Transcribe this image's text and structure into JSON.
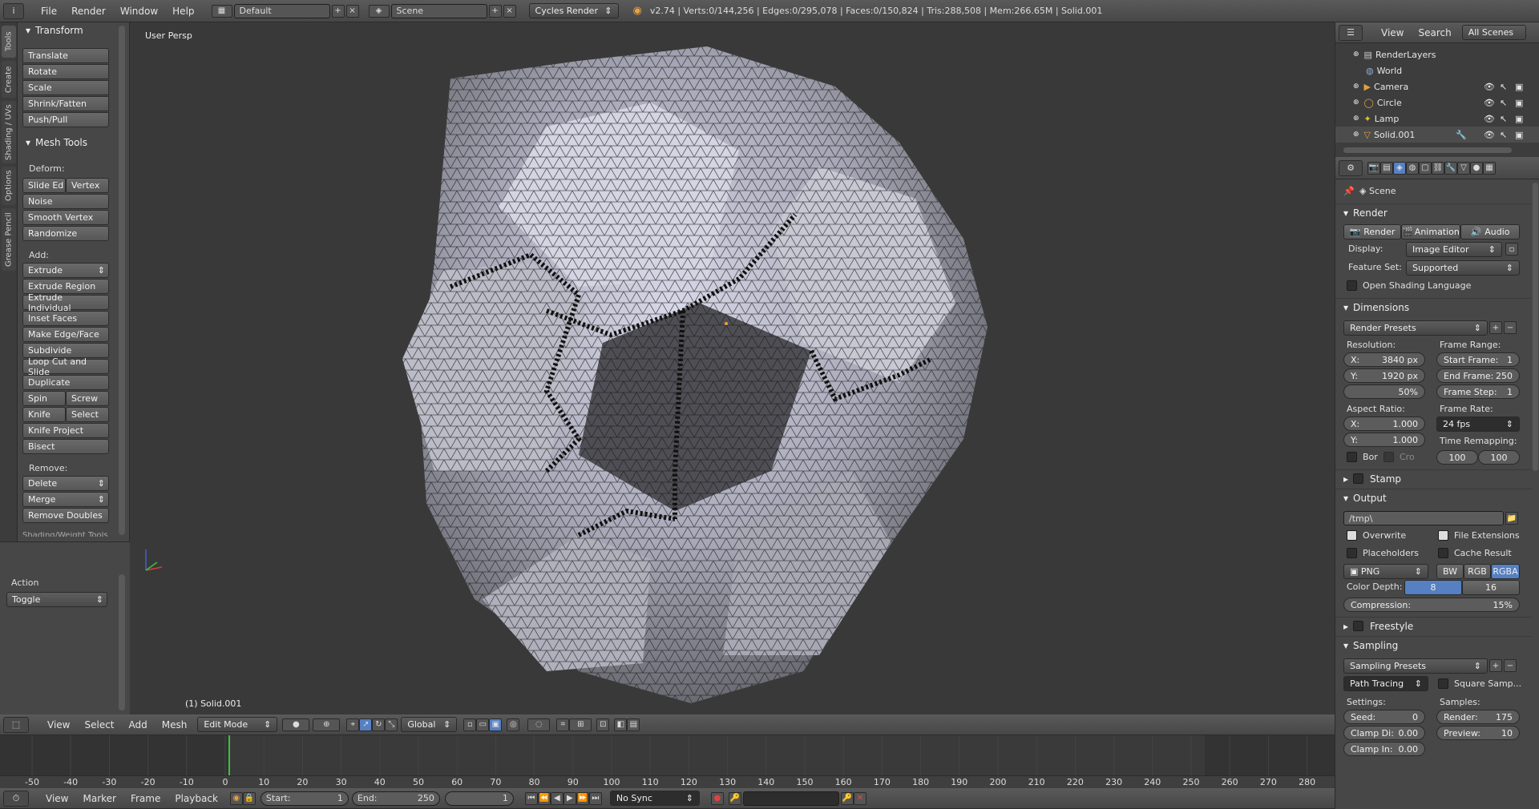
{
  "topbar": {
    "info_icon": "i",
    "menus": [
      "File",
      "Render",
      "Window",
      "Help"
    ],
    "layout": "Default",
    "scene": "Scene",
    "engine": "Cycles Render",
    "stats": "v2.74 | Verts:0/144,256 | Edges:0/295,078 | Faces:0/150,824 | Tris:288,508 | Mem:266.65M | Solid.001"
  },
  "toolshelf": {
    "tabs": [
      "Tools",
      "Create",
      "Shading / UVs",
      "Options",
      "Grease Pencil"
    ],
    "transform_title": "Transform",
    "transform": [
      "Translate",
      "Rotate",
      "Scale",
      "Shrink/Fatten",
      "Push/Pull"
    ],
    "meshtools_title": "Mesh Tools",
    "deform_label": "Deform:",
    "slide_edge": "Slide Ed",
    "vertex": "Vertex",
    "noise": "Noise",
    "smooth_vertex": "Smooth Vertex",
    "randomize": "Randomize",
    "add_label": "Add:",
    "extrude": "Extrude",
    "extrude_region": "Extrude Region",
    "extrude_individual": "Extrude Individual",
    "inset_faces": "Inset Faces",
    "make_edge_face": "Make Edge/Face",
    "subdivide": "Subdivide",
    "loop_cut": "Loop Cut and Slide",
    "duplicate": "Duplicate",
    "spin": "Spin",
    "screw": "Screw",
    "knife": "Knife",
    "select": "Select",
    "knife_project": "Knife Project",
    "bisect": "Bisect",
    "remove_label": "Remove:",
    "delete": "Delete",
    "merge": "Merge",
    "remove_doubles": "Remove Doubles",
    "cut_label": "Shading/Weight Tools",
    "action_title": "Action",
    "action_value": "Toggle"
  },
  "viewport": {
    "view_label": "User Persp",
    "object_label": "(1) Solid.001"
  },
  "view3d_header": {
    "menus": [
      "View",
      "Select",
      "Add",
      "Mesh"
    ],
    "mode": "Edit Mode",
    "orientation": "Global"
  },
  "outliner": {
    "view": "View",
    "search": "Search",
    "filter": "All Scenes",
    "items": [
      {
        "name": "RenderLayers",
        "icon": "renderlayers-icon"
      },
      {
        "name": "World",
        "icon": "world-icon"
      },
      {
        "name": "Camera",
        "icon": "camera-icon"
      },
      {
        "name": "Circle",
        "icon": "curve-icon"
      },
      {
        "name": "Lamp",
        "icon": "lamp-icon"
      },
      {
        "name": "Solid.001",
        "icon": "mesh-icon"
      }
    ]
  },
  "properties": {
    "context": "Scene",
    "render_title": "Render",
    "render_btn": "Render",
    "animation_btn": "Animation",
    "audio_btn": "Audio",
    "display_label": "Display:",
    "display_value": "Image Editor",
    "feature_label": "Feature Set:",
    "feature_value": "Supported",
    "osl_label": "Open Shading Language",
    "dimensions_title": "Dimensions",
    "render_presets": "Render Presets",
    "resolution_label": "Resolution:",
    "res_x": "3840 px",
    "res_y": "1920 px",
    "res_pct": "50%",
    "frame_range_label": "Frame Range:",
    "start_frame": "Start Frame:",
    "start_frame_v": "1",
    "end_frame": "End Frame:",
    "end_frame_v": "250",
    "frame_step": "Frame Step:",
    "frame_step_v": "1",
    "aspect_label": "Aspect Ratio:",
    "aspect_x": "1.000",
    "aspect_y": "1.000",
    "frame_rate_label": "Frame Rate:",
    "frame_rate": "24 fps",
    "time_remap_label": "Time Remapping:",
    "remap_old": "100",
    "remap_new": "100",
    "border_label": "Bor",
    "crop_label": "Cro",
    "stamp_title": "Stamp",
    "output_title": "Output",
    "output_path": "/tmp\\",
    "overwrite": "Overwrite",
    "file_ext": "File Extensions",
    "placeholders": "Placeholders",
    "cache_result": "Cache Result",
    "format": "PNG",
    "bw": "BW",
    "rgb": "RGB",
    "rgba": "RGBA",
    "color_depth_label": "Color Depth:",
    "depth_8": "8",
    "depth_16": "16",
    "compression": "Compression:",
    "compression_v": "15%",
    "freestyle_title": "Freestyle",
    "sampling_title": "Sampling",
    "sampling_presets": "Sampling Presets",
    "integrator": "Path Tracing",
    "square_samples": "Square Samp...",
    "settings_label": "Settings:",
    "samples_label": "Samples:",
    "seed": "Seed:",
    "seed_v": "0",
    "render_samples": "Render:",
    "render_samples_v": "175",
    "clamp_direct": "Clamp Di:",
    "clamp_direct_v": "0.00",
    "preview_samples": "Preview:",
    "preview_samples_v": "10",
    "clamp_indirect": "Clamp In:",
    "clamp_indirect_v": "0.00"
  },
  "timeline": {
    "ticks": [
      "-50",
      "-40",
      "-30",
      "-20",
      "-10",
      "0",
      "10",
      "20",
      "30",
      "40",
      "50",
      "60",
      "70",
      "80",
      "90",
      "100",
      "110",
      "120",
      "130",
      "140",
      "150",
      "160",
      "170",
      "180",
      "190",
      "200",
      "210",
      "220",
      "230",
      "240",
      "250",
      "260",
      "270",
      "280"
    ],
    "current_frame_marker": "0"
  },
  "timeline_header": {
    "menus": [
      "View",
      "Marker",
      "Frame",
      "Playback"
    ],
    "start_label": "Start:",
    "start": "1",
    "end_label": "End:",
    "end": "250",
    "current": "1",
    "sync": "No Sync"
  },
  "colors": {
    "accent_blue": "#5680c2",
    "timeline_cursor": "#3fbf3f"
  }
}
